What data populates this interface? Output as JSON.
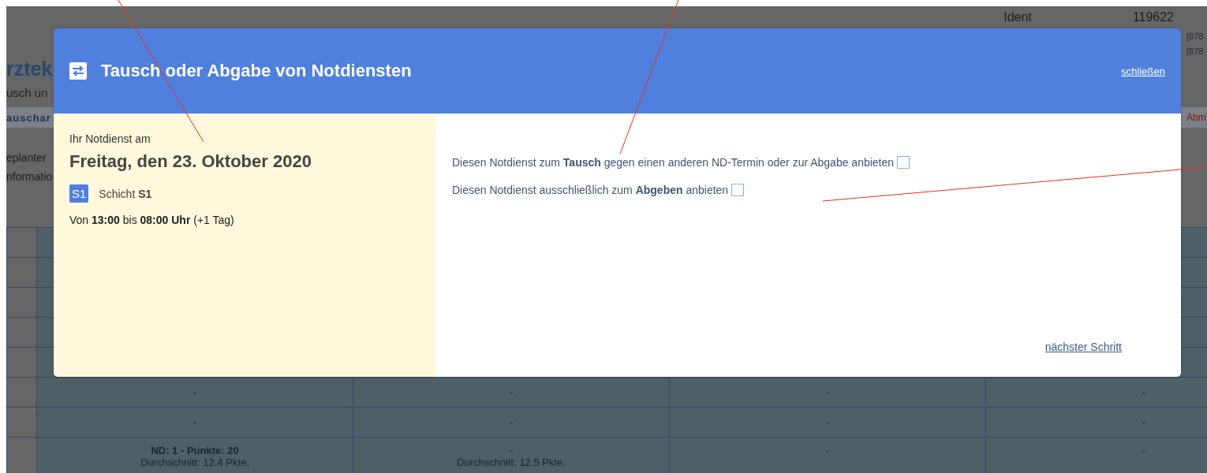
{
  "background": {
    "ident_label": "Ident",
    "ident_value": "119622",
    "refs": [
      "[878",
      "[878"
    ],
    "heading": "rztek",
    "subtitle": "usch un",
    "tab_label": "auschar",
    "alert": "Abm",
    "info_lines": [
      "eplanter",
      "nformatio"
    ],
    "table": {
      "rows": [
        {
          "cells": [
            {
              "lines": [
                {
                  "text": "-",
                  "bold": false
                }
              ]
            },
            {
              "lines": [
                {
                  "text": "-",
                  "bold": false
                }
              ]
            },
            {
              "lines": [
                {
                  "text": "-",
                  "bold": false
                }
              ]
            },
            {
              "lines": [
                {
                  "text": "-",
                  "bold": false
                }
              ]
            }
          ]
        },
        {
          "cells": [
            {
              "lines": [
                {
                  "text": "-",
                  "bold": false
                }
              ]
            },
            {
              "lines": [
                {
                  "text": "-",
                  "bold": false
                }
              ]
            },
            {
              "lines": [
                {
                  "text": "-",
                  "bold": false
                }
              ]
            },
            {
              "lines": [
                {
                  "text": "-",
                  "bold": false
                }
              ]
            }
          ]
        },
        {
          "cells": [
            {
              "lines": [
                {
                  "text": "ND: 1 - Punkte: 20",
                  "bold": true
                },
                {
                  "text": "Durchschnitt: 12.4 Pkte.",
                  "bold": false
                }
              ]
            },
            {
              "lines": [
                {
                  "text": "-",
                  "bold": false
                },
                {
                  "text": "Durchschnitt: 12.5 Pkte.",
                  "bold": false
                }
              ]
            },
            {
              "lines": [
                {
                  "text": "-",
                  "bold": false
                }
              ]
            },
            {
              "lines": [
                {
                  "text": "-",
                  "bold": false
                }
              ]
            }
          ]
        }
      ]
    }
  },
  "dialog": {
    "title": "Tausch oder Abgabe von Notdiensten",
    "close_link": "schließen",
    "duty": {
      "intro": "Ihr Notdienst am",
      "date": "Freitag, den 23. Oktober 2020",
      "shift_badge": "S1",
      "shift_text": "Schicht **S1**",
      "time": "Von **13:00** bis **08:00 Uhr** (+1 Tag)"
    },
    "options": [
      {
        "text": "Diesen Notdienst zum **Tausch** gegen einen anderen ND-Termin oder zur Abgabe anbieten",
        "checked": false
      },
      {
        "text": "Diesen Notdienst ausschließlich zum **Abgeben** anbieten",
        "checked": false
      }
    ],
    "next_link": "nächster Schritt"
  }
}
